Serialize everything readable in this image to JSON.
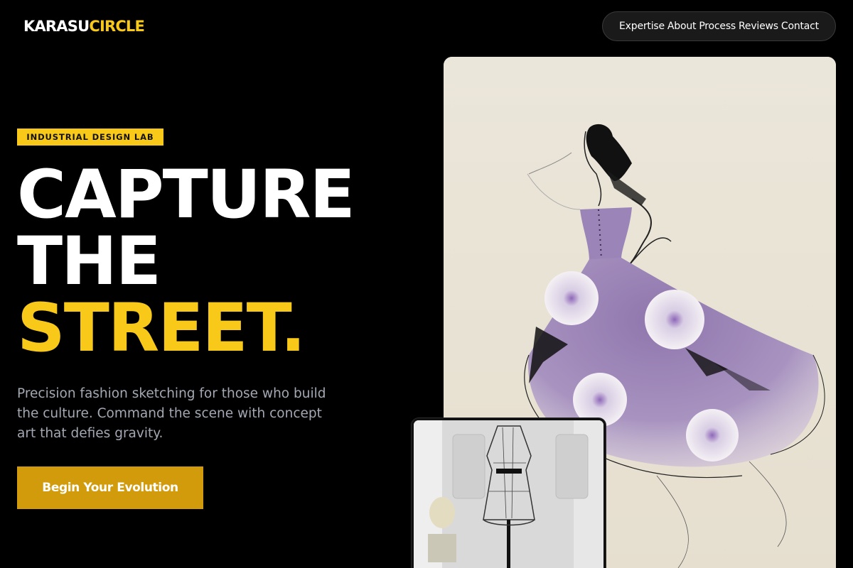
{
  "header": {
    "logo_part1": "KARASU",
    "logo_part2": "CIRCLE",
    "nav": [
      "Expertise",
      "About",
      "Process",
      "Reviews",
      "Contact"
    ]
  },
  "hero": {
    "badge": "INDUSTRIAL DESIGN LAB",
    "headline_line1": "CAPTURE",
    "headline_line2": "THE",
    "headline_line3": "STREET.",
    "description": "Precision fashion sketching for those who build the culture. Command the scene with concept art that defies gravity.",
    "cta_label": "Begin Your Evolution"
  },
  "images": {
    "main": "fashion-sketch-purple-ballgown",
    "secondary": "wire-dress-form-mannequin"
  },
  "colors": {
    "background": "#000000",
    "accent_yellow": "#f9c91a",
    "cta": "#d29b0c",
    "body_text": "#a3a8b3"
  }
}
